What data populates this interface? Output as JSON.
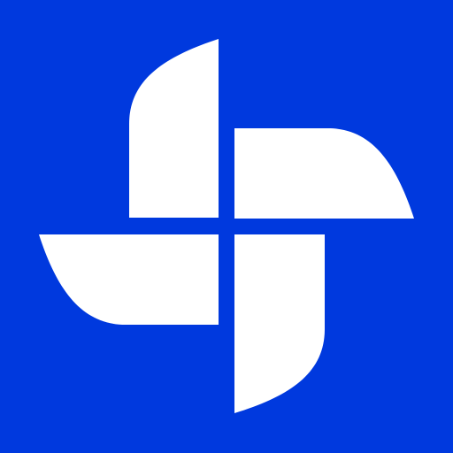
{
  "colors": {
    "background": "#0039DE",
    "glyph": "#FFFFFF"
  },
  "icon": {
    "name": "pinwheel-logo-icon"
  }
}
